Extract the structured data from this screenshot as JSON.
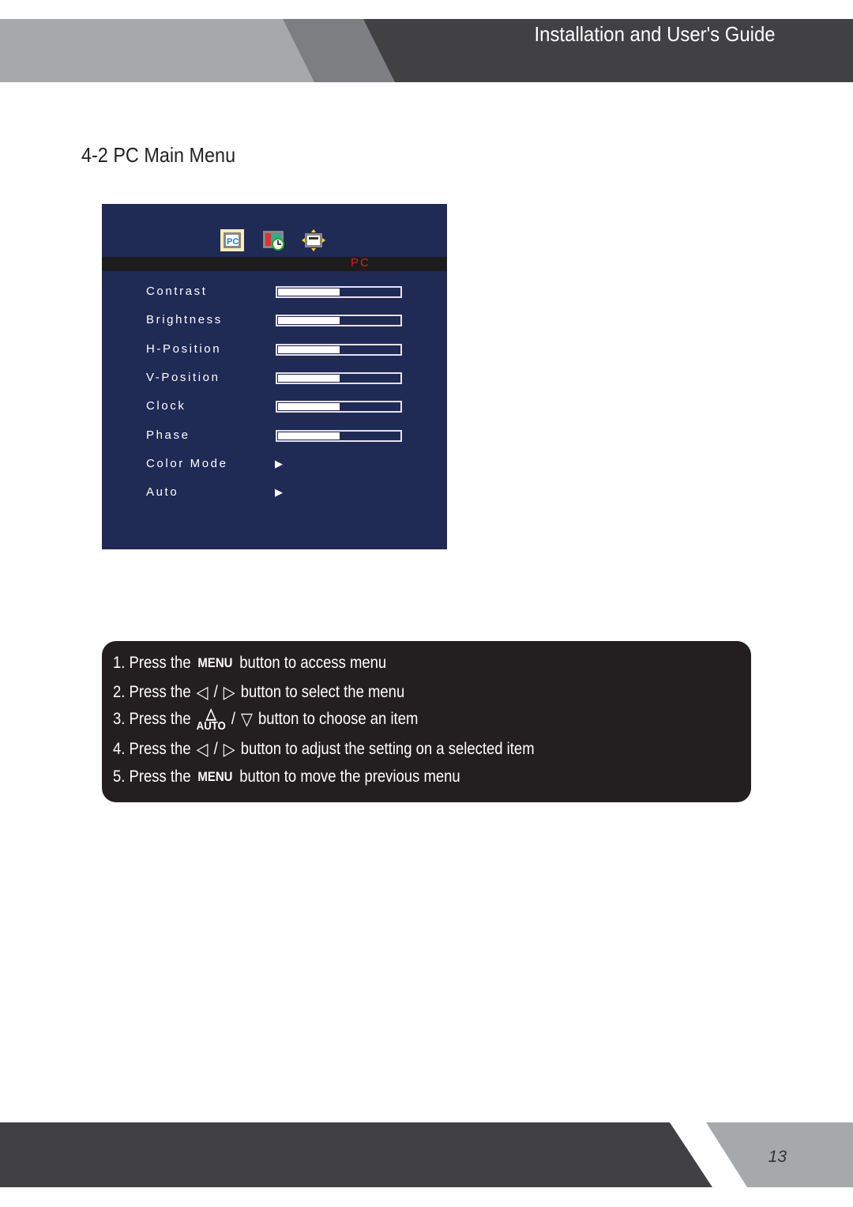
{
  "header": {
    "title": "Installation and User's Guide"
  },
  "section": {
    "title": "4-2 PC Main Menu"
  },
  "osd": {
    "icons": [
      "pc-icon",
      "clock-icon",
      "position-icon"
    ],
    "selected_tab": "PC",
    "items": [
      {
        "label": "Contrast",
        "type": "slider",
        "value": 50
      },
      {
        "label": "Brightness",
        "type": "slider",
        "value": 50
      },
      {
        "label": "H-Position",
        "type": "slider",
        "value": 50
      },
      {
        "label": "V-Position",
        "type": "slider",
        "value": 50
      },
      {
        "label": "Clock",
        "type": "slider",
        "value": 50
      },
      {
        "label": "Phase",
        "type": "slider",
        "value": 50
      },
      {
        "label": "Color Mode",
        "type": "submenu"
      },
      {
        "label": "Auto",
        "type": "submenu"
      }
    ],
    "colors": {
      "background": "#1f2a55",
      "tab_text": "#d42020"
    }
  },
  "instructions": {
    "press": [
      "1. Press the",
      "2. Press the",
      "3. Press the",
      "4. Press the",
      "5. Press the"
    ],
    "menu_key": "MENU",
    "auto_key": "AUTO",
    "slash": "/",
    "texts": [
      "button to access menu",
      "button to select the menu",
      "button to choose an item",
      "button to adjust the setting on a selected item",
      "button to move the previous menu"
    ]
  },
  "footer": {
    "page_number": "13"
  }
}
